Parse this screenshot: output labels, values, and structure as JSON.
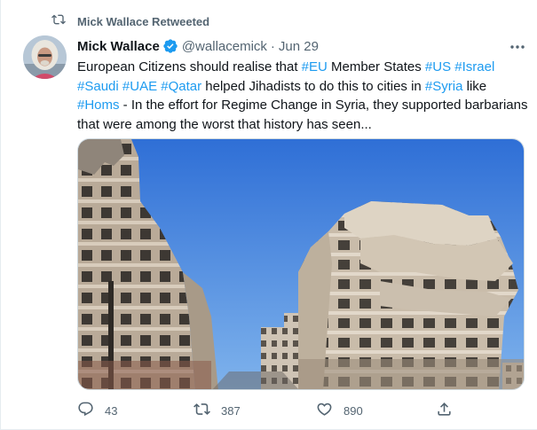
{
  "retweet": {
    "icon": "retweet-icon",
    "label": "Mick Wallace Retweeted"
  },
  "author": {
    "display_name": "Mick Wallace",
    "handle": "@wallacemick",
    "separator": "·",
    "date": "Jun 29",
    "verified_icon": "verified-badge-icon"
  },
  "tweet": {
    "segments": [
      {
        "text": "European Citizens should realise that ",
        "tag": false
      },
      {
        "text": "#EU",
        "tag": true
      },
      {
        "text": " Member States ",
        "tag": false
      },
      {
        "text": "#US",
        "tag": true
      },
      {
        "text": " ",
        "tag": false
      },
      {
        "text": "#Israel",
        "tag": true
      },
      {
        "text": " ",
        "tag": false
      },
      {
        "text": "#Saudi",
        "tag": true
      },
      {
        "text": " ",
        "tag": false
      },
      {
        "text": "#UAE",
        "tag": true
      },
      {
        "text": " ",
        "tag": false
      },
      {
        "text": "#Qatar",
        "tag": true
      },
      {
        "text": " helped Jihadists to do this to cities in ",
        "tag": false
      },
      {
        "text": "#Syria",
        "tag": true
      },
      {
        "text": " like ",
        "tag": false
      },
      {
        "text": "#Homs",
        "tag": true
      },
      {
        "text": " - In the effort for Regime Change in Syria, they supported barbarians that were among the worst that history has seen...",
        "tag": false
      }
    ]
  },
  "actions": {
    "reply_count": "43",
    "retweet_count": "387",
    "like_count": "890"
  },
  "colors": {
    "link": "#1d9bf0",
    "secondary_text": "#536471",
    "verified": "#1d9bf0"
  }
}
